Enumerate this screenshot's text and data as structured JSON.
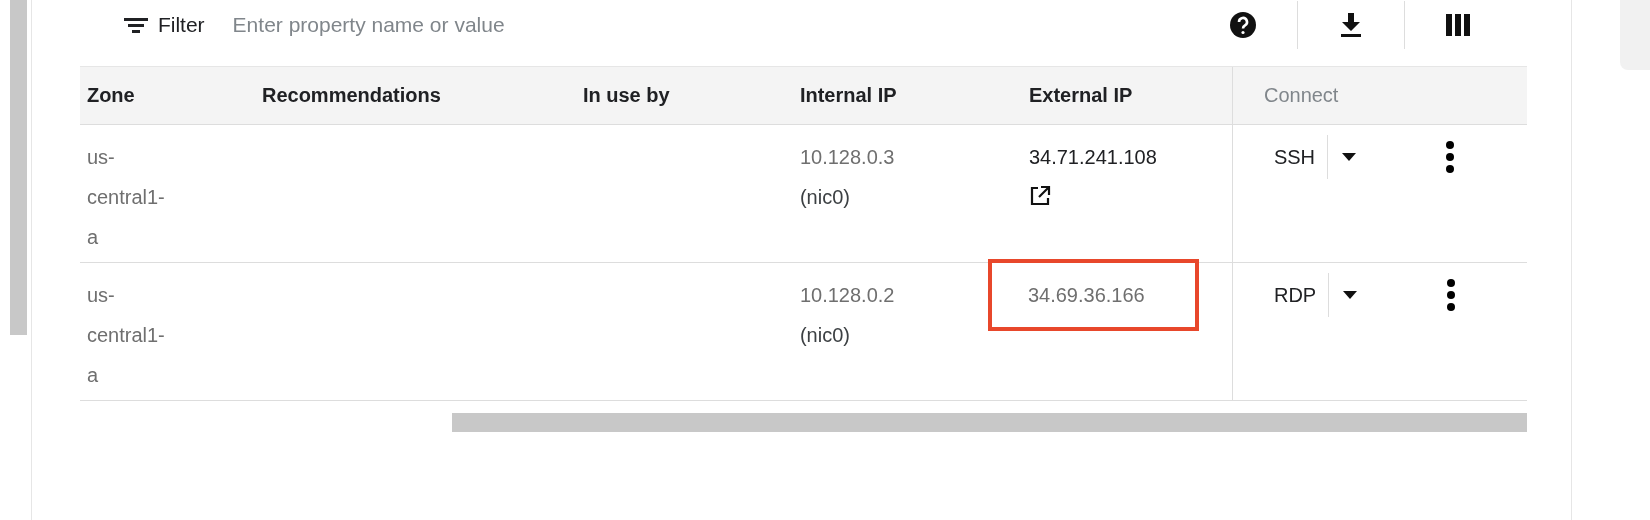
{
  "toolbar": {
    "filter_label": "Filter",
    "filter_placeholder": "Enter property name or value"
  },
  "table": {
    "columns": [
      {
        "label": "Zone",
        "muted": false
      },
      {
        "label": "Recommendations",
        "muted": false
      },
      {
        "label": "In use by",
        "muted": false
      },
      {
        "label": "Internal IP",
        "muted": false
      },
      {
        "label": "External IP",
        "muted": false
      },
      {
        "label": "Connect",
        "muted": true
      }
    ],
    "rows": [
      {
        "zone": "us-central1-a",
        "internal_ip": "10.128.0.3",
        "nic": "(nic0)",
        "external_ip": "34.71.241.108",
        "external_link": true,
        "highlighted": false,
        "connect": "SSH"
      },
      {
        "zone": "us-central1-a",
        "internal_ip": "10.128.0.2",
        "nic": "(nic0)",
        "external_ip": "34.69.36.166",
        "external_link": false,
        "highlighted": true,
        "connect": "RDP"
      }
    ]
  }
}
